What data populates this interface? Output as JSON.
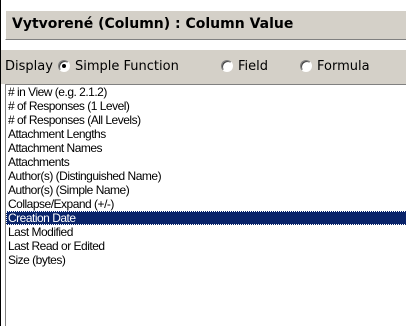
{
  "header": {
    "title": "Vytvorené (Column) : Column Value"
  },
  "display": {
    "label": "Display",
    "options": [
      {
        "label": "Simple Function",
        "selected": true
      },
      {
        "label": "Field",
        "selected": false
      },
      {
        "label": "Formula",
        "selected": false
      }
    ]
  },
  "list": {
    "items": [
      "# in View (e.g. 2.1.2)",
      "# of Responses (1 Level)",
      "# of Responses (All Levels)",
      "Attachment Lengths",
      "Attachment Names",
      "Attachments",
      "Author(s) (Distinguished Name)",
      "Author(s) (Simple Name)",
      "Collapse/Expand (+/-)",
      "Creation Date",
      "Last Modified",
      "Last Read or Edited",
      "Size (bytes)"
    ],
    "selected_item": "Creation Date"
  },
  "colors": {
    "selection": "#0a246a",
    "dialog_face": "#d4d0c8"
  }
}
